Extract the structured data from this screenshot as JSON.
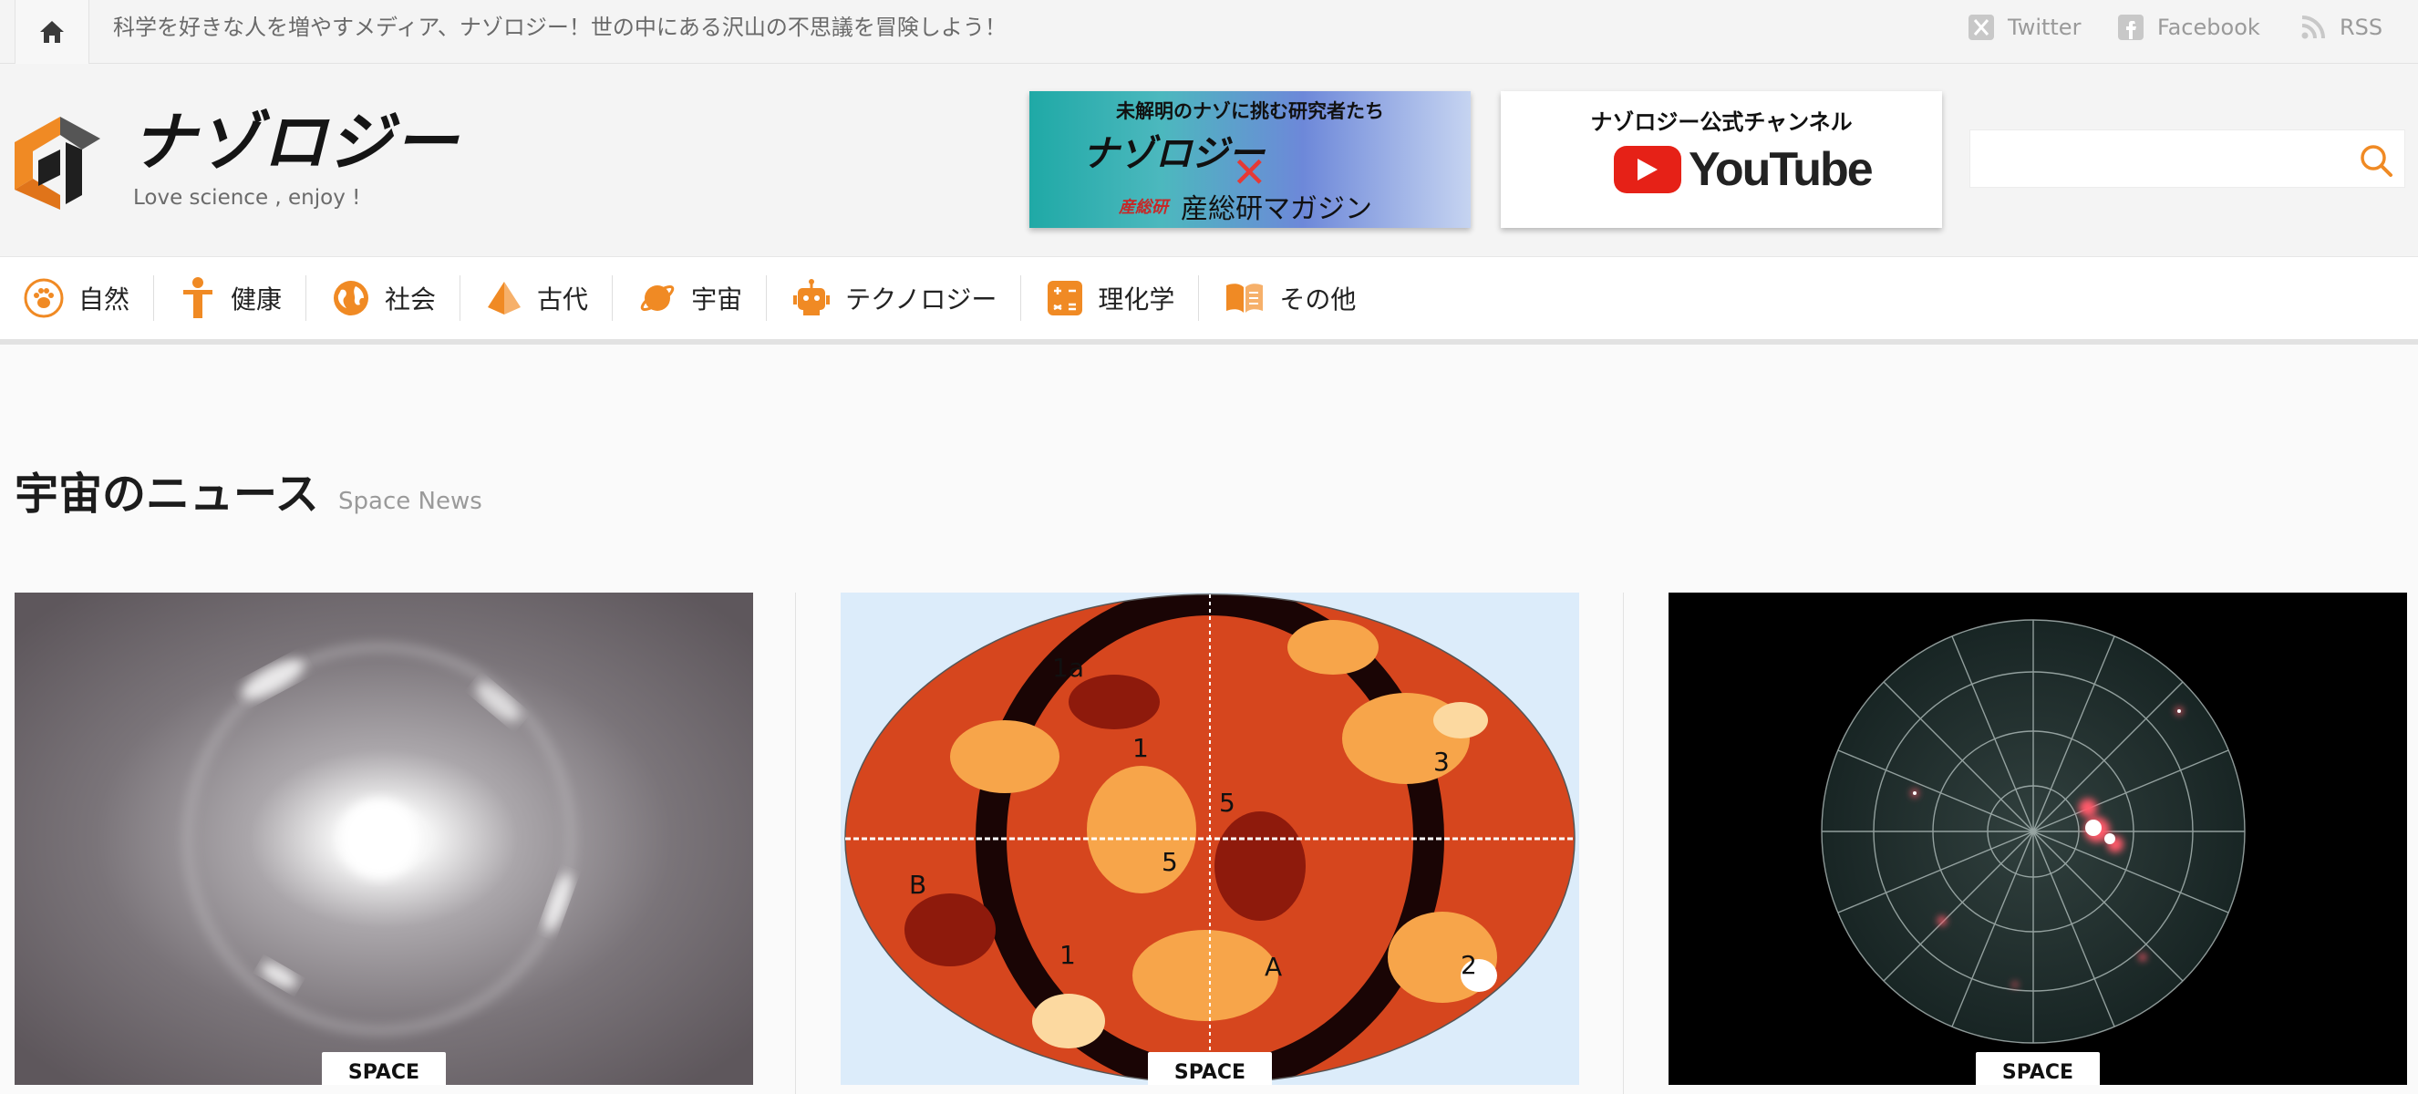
{
  "topbar": {
    "tagline": "科学を好きな人を増やすメディア、ナゾロジー！世の中にある沢山の不思議を冒険しよう！",
    "social": [
      {
        "label": "Twitter",
        "icon": "x-icon"
      },
      {
        "label": "Facebook",
        "icon": "facebook-icon"
      },
      {
        "label": "RSS",
        "icon": "rss-icon"
      }
    ]
  },
  "header": {
    "logo_text": "ナゾロジー",
    "logo_sub": "Love science , enjoy !",
    "banner_aist": {
      "top": "未解明のナゾに挑む研究者たち",
      "logo": "ナゾロジー",
      "brand": "産総研",
      "bottom": "産総研マガジン"
    },
    "banner_youtube": {
      "title": "ナゾロジー公式チャンネル",
      "word": "YouTube"
    },
    "search_placeholder": ""
  },
  "nav": [
    {
      "label": "自然",
      "icon": "paw-icon"
    },
    {
      "label": "健康",
      "icon": "person-icon"
    },
    {
      "label": "社会",
      "icon": "globe-icon"
    },
    {
      "label": "古代",
      "icon": "pyramid-icon"
    },
    {
      "label": "宇宙",
      "icon": "planet-icon"
    },
    {
      "label": "テクノロジー",
      "icon": "robot-icon"
    },
    {
      "label": "理化学",
      "icon": "calculator-icon"
    },
    {
      "label": "その他",
      "icon": "book-icon"
    }
  ],
  "section": {
    "title": "宇宙のニュース",
    "subtitle": "Space News"
  },
  "cards": [
    {
      "label": "SPACE",
      "image": "einstein-ring-image"
    },
    {
      "label": "SPACE",
      "image": "sky-map-image",
      "map_labels": [
        "1a",
        "1",
        "3",
        "5",
        "5",
        "B",
        "1",
        "A",
        "2"
      ]
    },
    {
      "label": "SPACE",
      "image": "polar-sky-image"
    }
  ],
  "colors": {
    "accent": "#f08a24",
    "text": "#222222",
    "muted": "#9a9a9a"
  }
}
